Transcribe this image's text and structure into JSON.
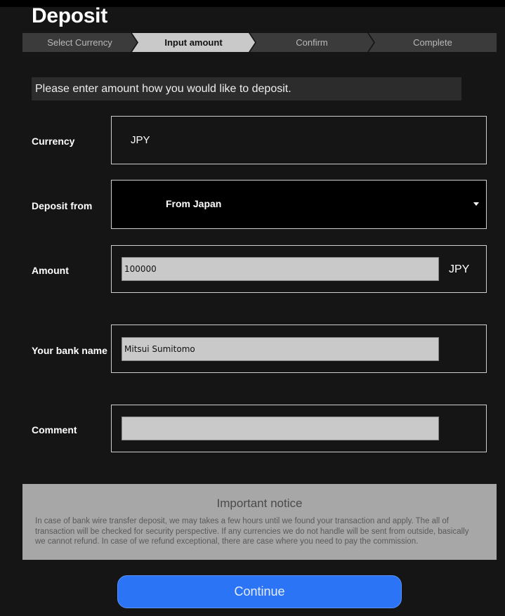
{
  "page": {
    "title": "Deposit"
  },
  "steps": [
    {
      "label": "Select Currency",
      "active": false
    },
    {
      "label": "Input amount",
      "active": true
    },
    {
      "label": "Confirm",
      "active": false
    },
    {
      "label": "Complete",
      "active": false
    }
  ],
  "instruction": "Please enter amount how you would like to deposit.",
  "form": {
    "currency": {
      "label": "Currency",
      "value": "JPY"
    },
    "deposit_from": {
      "label": "Deposit from",
      "value": "From Japan"
    },
    "amount": {
      "label": "Amount",
      "value": "100000",
      "unit": "JPY"
    },
    "bank_name": {
      "label": "Your bank name",
      "value": "Mitsui Sumitomo"
    },
    "comment": {
      "label": "Comment",
      "value": ""
    }
  },
  "notice": {
    "title": "Important notice",
    "body": "In case of bank wire transfer deposit, we may takes a few hours until we found your transaction and apply. The all of transaction will be checked for security perspective. If any currencies we do not handle will be sent from outside, basically we cannot refund. In case of we refund exceptional, there are case where you need to pay the commission."
  },
  "actions": {
    "continue_label": "Continue"
  },
  "colors": {
    "step_inactive": "#3b3b3b",
    "step_active": "#c9c9c9",
    "accent": "#2a74f5",
    "notice_bg": "#a7a7a7"
  }
}
